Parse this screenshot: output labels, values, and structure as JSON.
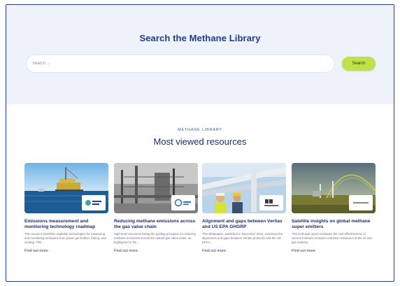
{
  "hero": {
    "title": "Search the Methane Library",
    "search_placeholder": "Search ...",
    "search_button": "Search"
  },
  "section": {
    "eyebrow": "METHANE LIBRARY",
    "title": "Most viewed resources"
  },
  "cards": [
    {
      "title": "Emissions measurement and monitoring technology roadmap",
      "description": "This resource identifies available technologies for measuring and monitoring emissions from power generation, flaring, and venting. This...",
      "link": "Find out more",
      "image_icon": "offshore-platform-image"
    },
    {
      "title": "Reducing methane emissions across the gas value chain",
      "description": "High-level document listing the guiding principles for reducing methane emissions across the natural gas value chain, as highlighted in the ...",
      "link": "Find out more",
      "image_icon": "gas-facility-image"
    },
    {
      "title": "Alignment and gaps between Veritas and US EPA GHGRP",
      "description": "This whitepaper, published in December 2024, examines the alignments and gaps between Veritas protocols and the US EPA's...",
      "link": "Find out more",
      "image_icon": "workers-pipes-image"
    },
    {
      "title": "Satellite insights on global methane super emitters",
      "description": "This technical report evaluates the cost-effectiveness of various methane emission reduction measures at the oil and gas industry...",
      "link": "Find out more",
      "image_icon": "rainbow-field-image"
    }
  ],
  "colors": {
    "hero_bg": "#eef3fb",
    "accent_button": "#bfe14a",
    "title": "#1f3a86"
  }
}
